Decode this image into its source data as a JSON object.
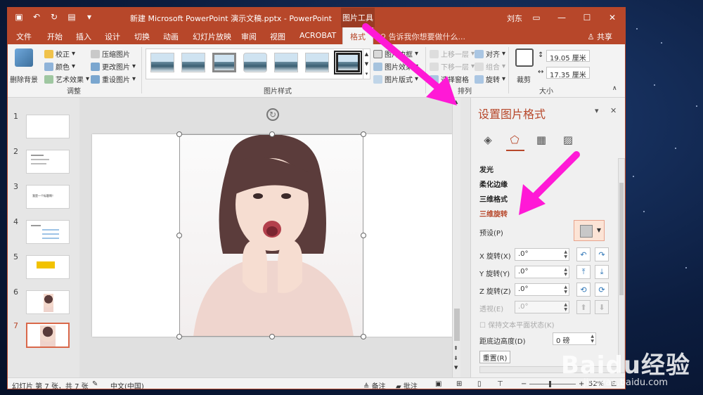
{
  "window": {
    "doc_title": "新建 Microsoft PowerPoint 演示文稿.pptx  -  PowerPoint",
    "context_tab": "图片工具",
    "user": "刘东",
    "share": "共享",
    "tell_me": "告诉我你想要做什么..."
  },
  "tabs": [
    "文件",
    "开始",
    "插入",
    "设计",
    "切换",
    "动画",
    "幻灯片放映",
    "审阅",
    "视图",
    "ACROBAT",
    "格式"
  ],
  "ribbon": {
    "remove_bg": "删除背景",
    "adjust": {
      "corrections": "校正",
      "color": "颜色",
      "artistic": "艺术效果",
      "compress": "压缩图片",
      "change": "更改图片",
      "reset": "重设图片",
      "label": "调整"
    },
    "styles_label": "图片样式",
    "style_options": {
      "border": "图片边框",
      "effects": "图片效果",
      "layout": "图片版式"
    },
    "arrange": {
      "forward": "上移一层",
      "backward": "下移一层",
      "selection_pane": "选择窗格",
      "align": "对齐",
      "group": "组合",
      "rotate": "旋转",
      "label": "排列"
    },
    "size": {
      "crop": "裁剪",
      "height": "19.05 厘米",
      "width": "17.35 厘米",
      "label": "大小"
    }
  },
  "slides": [
    "1",
    "2",
    "3",
    "4",
    "5",
    "6",
    "7"
  ],
  "slide_thumb_texts": {
    "s3": "我是一个标题啊！"
  },
  "format_pane": {
    "title": "设置图片格式",
    "sections": [
      "发光",
      "柔化边缘",
      "三维格式",
      "三维旋转"
    ],
    "preset_label": "预设(P)",
    "rows": [
      {
        "label": "X 旋转(X)",
        "value": ".0°"
      },
      {
        "label": "Y 旋转(Y)",
        "value": ".0°"
      },
      {
        "label": "Z 旋转(Z)",
        "value": ".0°"
      },
      {
        "label": "透视(E)",
        "value": ".0°"
      }
    ],
    "keep_text_flat": "保持文本平面状态(K)",
    "distance_label": "距底边高度(D)",
    "distance_value": "0 磅",
    "reset": "重置(R)"
  },
  "status": {
    "slide_info": "幻灯片 第 7 张，共 7 张",
    "language": "中文(中国)",
    "notes": "备注",
    "comments": "批注",
    "zoom": "52%"
  },
  "watermark": {
    "logo": "Baidu经验",
    "url": "jingyan.baidu.com"
  },
  "colors": {
    "accent": "#b7472a",
    "annotation_arrow": "#ff19d6"
  },
  "icons": {
    "undo": "undo-icon",
    "redo": "redo-icon",
    "save": "save-icon"
  }
}
